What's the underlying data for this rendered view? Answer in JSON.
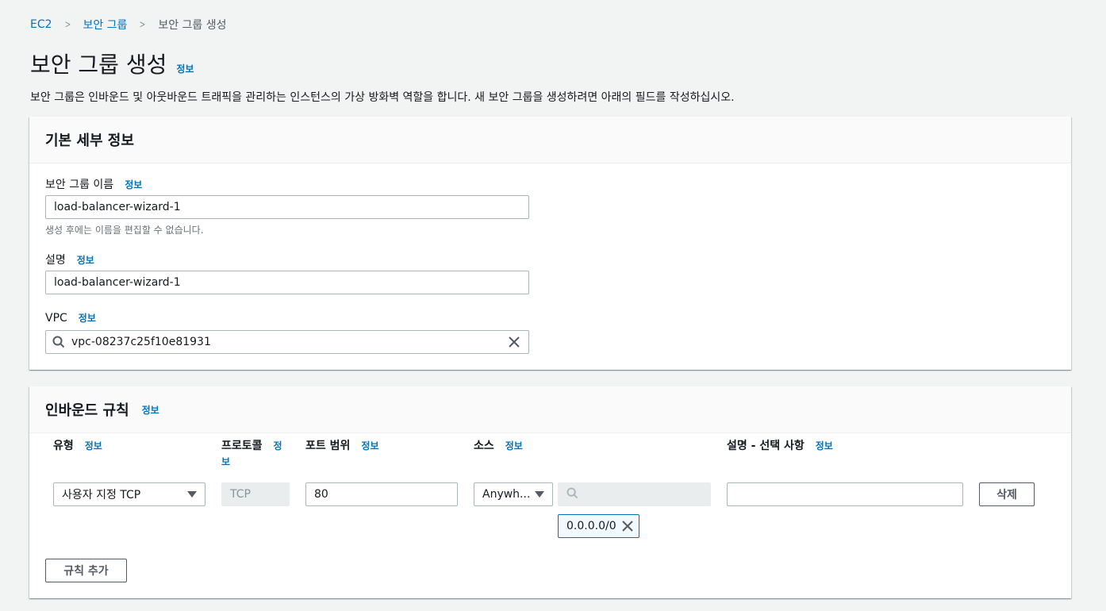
{
  "breadcrumb": {
    "items": [
      "EC2",
      "보안 그룹",
      "보안 그룹 생성"
    ]
  },
  "info_label": "정보",
  "page": {
    "title": "보안 그룹 생성",
    "description": "보안 그룹은 인바운드 및 아웃바운드 트래픽을 관리하는 인스턴스의 가상 방화벽 역할을 합니다. 새 보안 그룹을 생성하려면 아래의 필드를 작성하십시오."
  },
  "basic": {
    "header": "기본 세부 정보",
    "name_label": "보안 그룹 이름",
    "name_value": "load-balancer-wizard-1",
    "name_hint": "생성 후에는 이름을 편집할 수 없습니다.",
    "desc_label": "설명",
    "desc_value": "load-balancer-wizard-1",
    "vpc_label": "VPC",
    "vpc_value": "vpc-08237c25f10e81931"
  },
  "inbound": {
    "header": "인바운드 규칙",
    "columns": {
      "type": "유형",
      "protocol": "프로토콜",
      "port": "포트 범위",
      "source": "소스",
      "description": "설명 - 선택 사항"
    },
    "rule": {
      "type": "사용자 지정 TCP",
      "protocol": "TCP",
      "port": "80",
      "source": "Anywh...",
      "source_search_value": "",
      "cidr_token": "0.0.0.0/0",
      "description_value": ""
    },
    "delete_label": "삭제",
    "add_rule_label": "규칙 추가"
  }
}
